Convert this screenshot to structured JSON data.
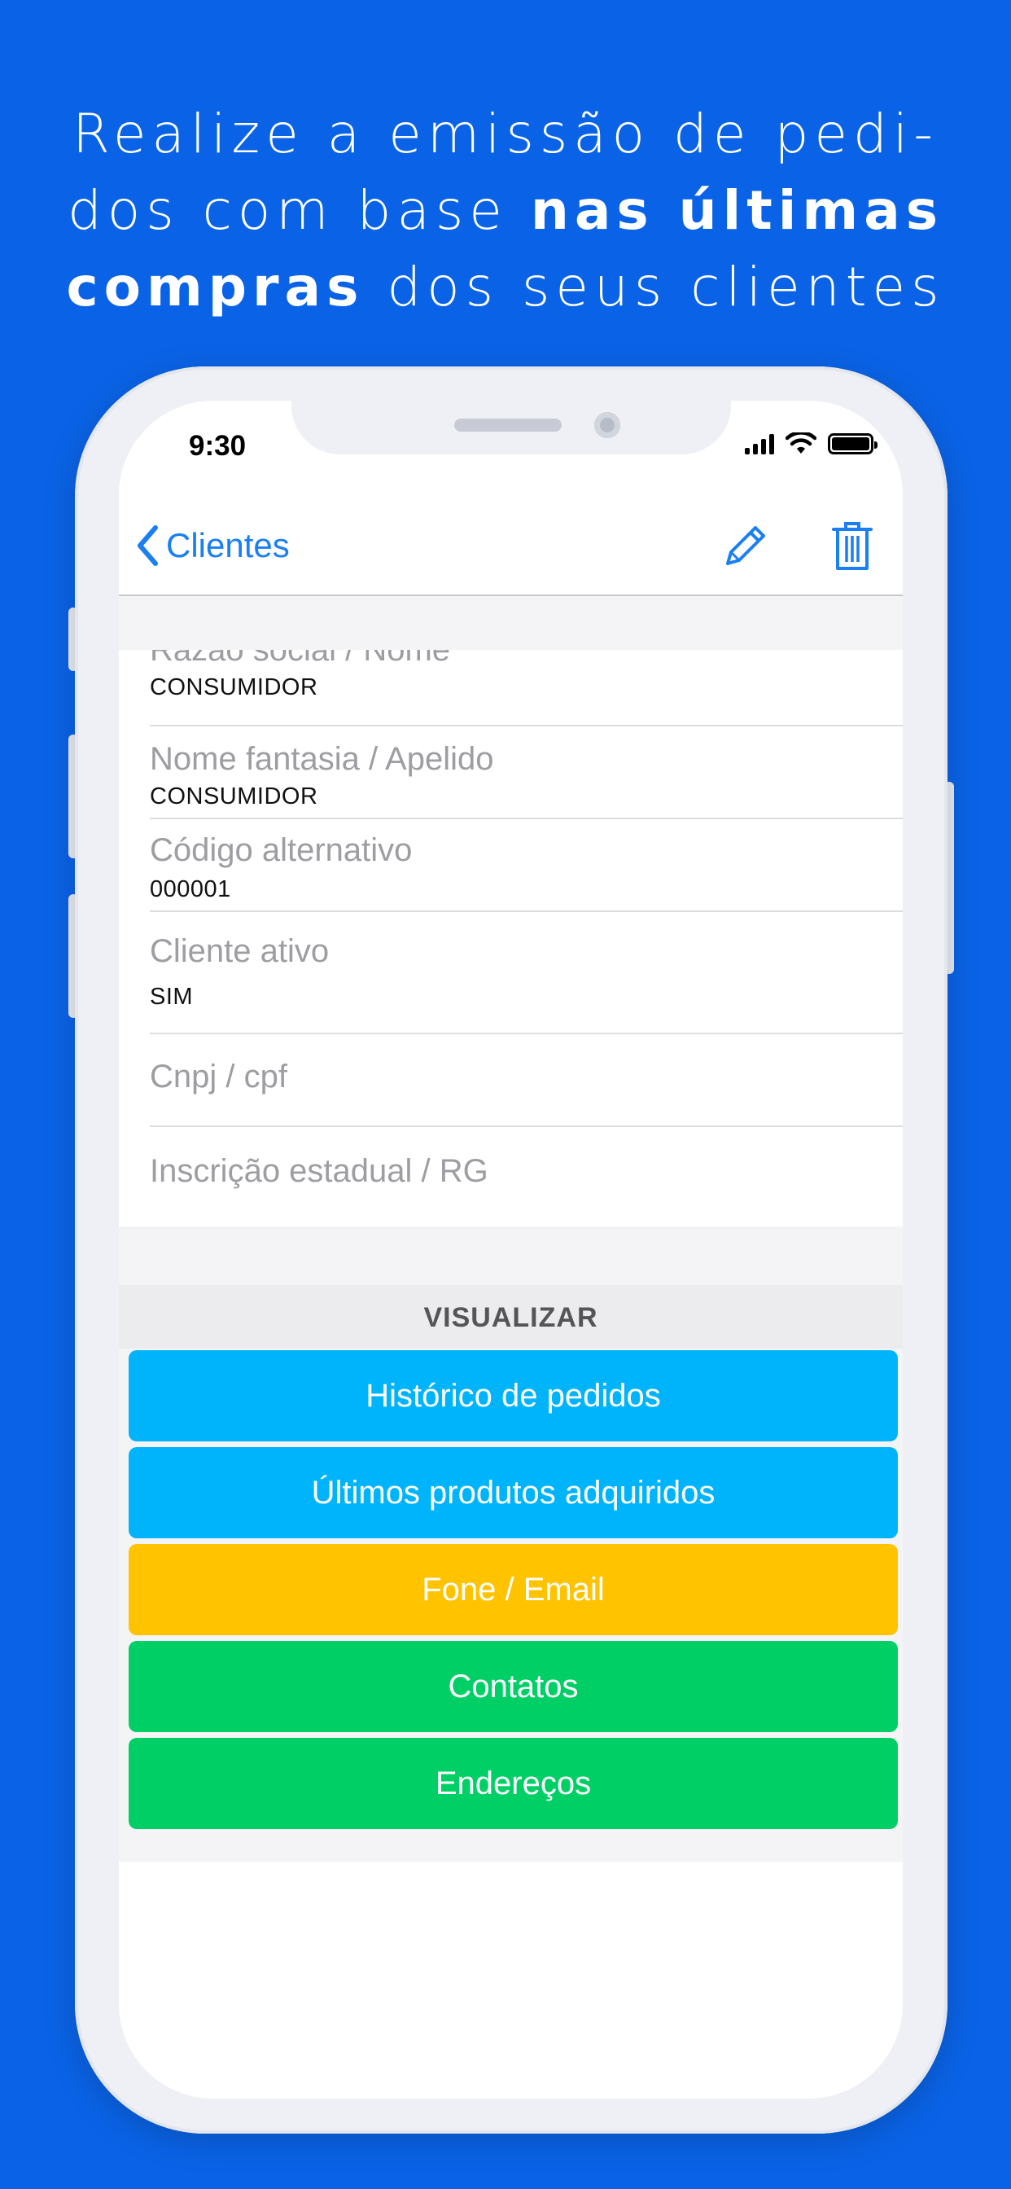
{
  "headline": {
    "line1": "Realize a emissão de pedi-",
    "line2_pre": "dos com base ",
    "line2_bold": "nas últimas",
    "line3_bold": "compras",
    "line3_post": " dos seus clientes"
  },
  "status_bar": {
    "time": "9:30"
  },
  "nav": {
    "back_label": "Clientes",
    "edit_icon": "pencil-icon",
    "delete_icon": "trash-icon"
  },
  "fields": [
    {
      "label": "Razão social / Nome",
      "value": "CONSUMIDOR"
    },
    {
      "label": "Nome fantasia / Apelido",
      "value": "CONSUMIDOR"
    },
    {
      "label": "Código alternativo",
      "value": "000001"
    },
    {
      "label": "Cliente ativo",
      "value": "SIM"
    },
    {
      "label": "Cnpj / cpf",
      "value": ""
    },
    {
      "label": "Inscrição estadual / RG",
      "value": ""
    }
  ],
  "section": {
    "title": "VISUALIZAR"
  },
  "buttons": [
    {
      "label": "Histórico de pedidos",
      "color": "#00b4fb"
    },
    {
      "label": "Últimos produtos adquiridos",
      "color": "#00b4fb"
    },
    {
      "label": "Fone / Email",
      "color": "#ffc300"
    },
    {
      "label": "Contatos",
      "color": "#00cf66"
    },
    {
      "label": "Endereços",
      "color": "#00cf66"
    }
  ],
  "colors": {
    "background": "#0a63e6",
    "ios_blue": "#1a7ff2"
  }
}
